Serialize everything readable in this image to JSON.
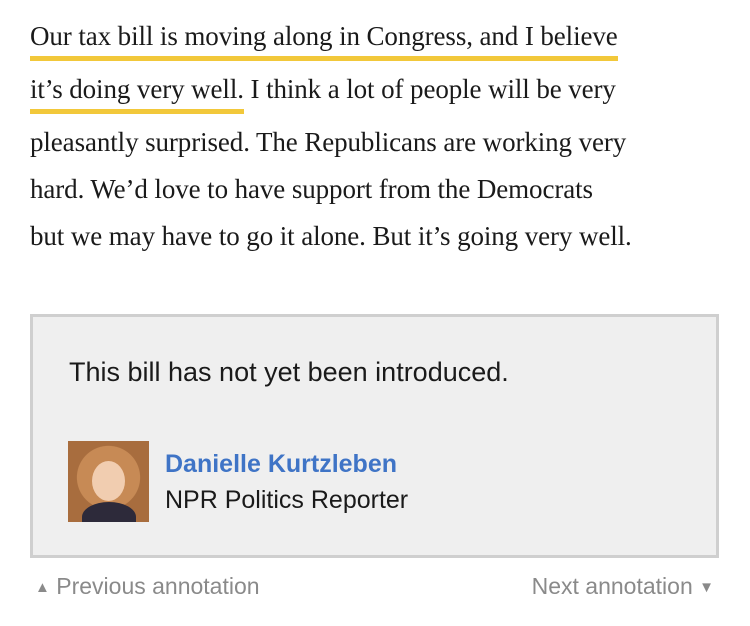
{
  "quote": {
    "lines": [
      "Our tax bill is moving along in Congress, and I believe",
      "it’s doing very well.",
      " I think a lot of people will be very",
      "pleasantly surprised. The Republicans are working very",
      "hard. We’d love to have support from the Democrats",
      "but we may have to go it alone. But it’s going very well."
    ],
    "highlight_color": "#f2c83a"
  },
  "annotation": {
    "note": "This bill has not yet been introduced.",
    "author_name": "Danielle Kurtzleben",
    "author_role": "NPR Politics Reporter",
    "author_name_color": "#3f74c6"
  },
  "navigation": {
    "prev_label": "Previous annotation",
    "next_label": "Next annotation",
    "prev_icon": "▲",
    "next_icon": "▼"
  }
}
